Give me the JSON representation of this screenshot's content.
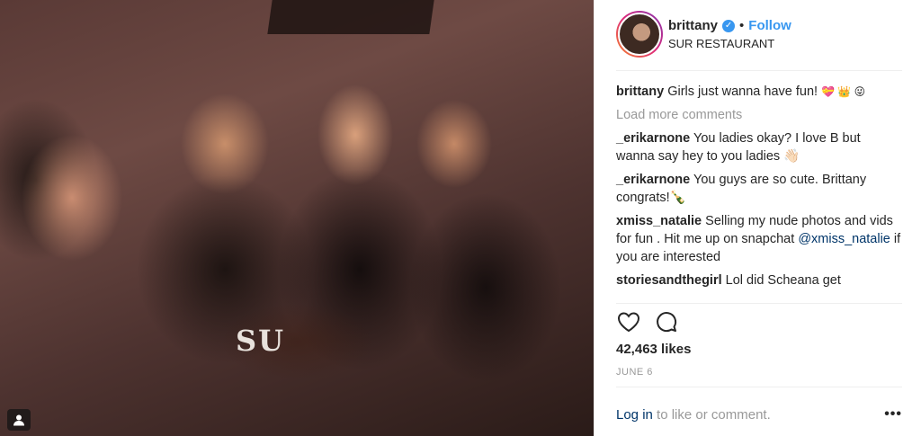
{
  "post": {
    "image_alt": "Four women posing for a selfie at SUR restaurant",
    "logo_text": "SU"
  },
  "header": {
    "username": "brittany",
    "separator": "•",
    "follow_label": "Follow",
    "location": "SUR RESTAURANT"
  },
  "caption": {
    "author": "brittany",
    "text": "Girls just wanna have fun!",
    "emojis": "💝 👑 😜"
  },
  "load_more_label": "Load more comments",
  "comments": [
    {
      "author": "_erikarnone",
      "text": "You ladies okay? I love B but wanna say hey to you ladies 👋🏻"
    },
    {
      "author": "_erikarnone",
      "text": "You guys are so cute. Brittany congrats!🍾"
    },
    {
      "author": "xmiss_natalie",
      "text": "Selling my nude photos and vids for fun . Hit me up on snapchat",
      "mention": "@xmiss_natalie",
      "text_after": "if you are interested"
    },
    {
      "author": "storiesandthegirl",
      "text": "Lol did Scheana get"
    }
  ],
  "likes": "42,463 likes",
  "date": "JUNE 6",
  "footer": {
    "login_label": "Log in",
    "login_suffix": "to like or comment.",
    "more_label": "•••"
  },
  "icons": [
    "user-tag-icon",
    "verified-icon",
    "heart-icon",
    "comment-icon",
    "more-options-icon"
  ],
  "colors": {
    "link": "#3897f0",
    "mention": "#003569",
    "muted": "#999999"
  }
}
